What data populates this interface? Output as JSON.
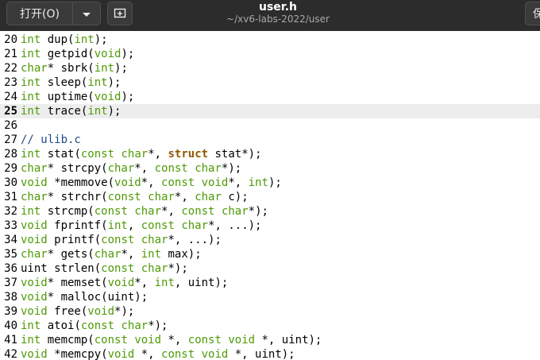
{
  "header": {
    "open_label": "打开(O)",
    "title": "user.h",
    "subtitle": "~/xv6-labs-2022/user",
    "right_label": "保"
  },
  "icons": {
    "dropdown": "chevron-down-icon",
    "new_tab": "new-tab-icon"
  },
  "colors": {
    "type": "#4e9a06",
    "keyword": "#8f5902",
    "comment": "#204a87",
    "current_line": "#ededed",
    "header_bg": "#2c2c2c"
  },
  "editor": {
    "current_line": 25,
    "lines": [
      {
        "num": "20",
        "tokens": [
          {
            "t": "int",
            "c": "type"
          },
          {
            "t": " dup(",
            "c": "plain"
          },
          {
            "t": "int",
            "c": "type"
          },
          {
            "t": ");",
            "c": "plain"
          }
        ]
      },
      {
        "num": "21",
        "tokens": [
          {
            "t": "int",
            "c": "type"
          },
          {
            "t": " getpid(",
            "c": "plain"
          },
          {
            "t": "void",
            "c": "type"
          },
          {
            "t": ");",
            "c": "plain"
          }
        ]
      },
      {
        "num": "22",
        "tokens": [
          {
            "t": "char",
            "c": "type"
          },
          {
            "t": "* sbrk(",
            "c": "plain"
          },
          {
            "t": "int",
            "c": "type"
          },
          {
            "t": ");",
            "c": "plain"
          }
        ]
      },
      {
        "num": "23",
        "tokens": [
          {
            "t": "int",
            "c": "type"
          },
          {
            "t": " sleep(",
            "c": "plain"
          },
          {
            "t": "int",
            "c": "type"
          },
          {
            "t": ");",
            "c": "plain"
          }
        ]
      },
      {
        "num": "24",
        "tokens": [
          {
            "t": "int",
            "c": "type"
          },
          {
            "t": " uptime(",
            "c": "plain"
          },
          {
            "t": "void",
            "c": "type"
          },
          {
            "t": ");",
            "c": "plain"
          }
        ]
      },
      {
        "num": "25",
        "tokens": [
          {
            "t": "int",
            "c": "type"
          },
          {
            "t": " trace(",
            "c": "plain"
          },
          {
            "t": "int",
            "c": "type"
          },
          {
            "t": ");",
            "c": "plain"
          }
        ]
      },
      {
        "num": "26",
        "tokens": []
      },
      {
        "num": "27",
        "tokens": [
          {
            "t": "// ulib.c",
            "c": "comment"
          }
        ]
      },
      {
        "num": "28",
        "tokens": [
          {
            "t": "int",
            "c": "type"
          },
          {
            "t": " stat(",
            "c": "plain"
          },
          {
            "t": "const",
            "c": "type"
          },
          {
            "t": " ",
            "c": "plain"
          },
          {
            "t": "char",
            "c": "type"
          },
          {
            "t": "*, ",
            "c": "plain"
          },
          {
            "t": "struct",
            "c": "kw"
          },
          {
            "t": " stat*);",
            "c": "plain"
          }
        ]
      },
      {
        "num": "29",
        "tokens": [
          {
            "t": "char",
            "c": "type"
          },
          {
            "t": "* strcpy(",
            "c": "plain"
          },
          {
            "t": "char",
            "c": "type"
          },
          {
            "t": "*, ",
            "c": "plain"
          },
          {
            "t": "const",
            "c": "type"
          },
          {
            "t": " ",
            "c": "plain"
          },
          {
            "t": "char",
            "c": "type"
          },
          {
            "t": "*);",
            "c": "plain"
          }
        ]
      },
      {
        "num": "30",
        "tokens": [
          {
            "t": "void",
            "c": "type"
          },
          {
            "t": " *memmove(",
            "c": "plain"
          },
          {
            "t": "void",
            "c": "type"
          },
          {
            "t": "*, ",
            "c": "plain"
          },
          {
            "t": "const",
            "c": "type"
          },
          {
            "t": " ",
            "c": "plain"
          },
          {
            "t": "void",
            "c": "type"
          },
          {
            "t": "*, ",
            "c": "plain"
          },
          {
            "t": "int",
            "c": "type"
          },
          {
            "t": ");",
            "c": "plain"
          }
        ]
      },
      {
        "num": "31",
        "tokens": [
          {
            "t": "char",
            "c": "type"
          },
          {
            "t": "* strchr(",
            "c": "plain"
          },
          {
            "t": "const",
            "c": "type"
          },
          {
            "t": " ",
            "c": "plain"
          },
          {
            "t": "char",
            "c": "type"
          },
          {
            "t": "*, ",
            "c": "plain"
          },
          {
            "t": "char",
            "c": "type"
          },
          {
            "t": " c);",
            "c": "plain"
          }
        ]
      },
      {
        "num": "32",
        "tokens": [
          {
            "t": "int",
            "c": "type"
          },
          {
            "t": " strcmp(",
            "c": "plain"
          },
          {
            "t": "const",
            "c": "type"
          },
          {
            "t": " ",
            "c": "plain"
          },
          {
            "t": "char",
            "c": "type"
          },
          {
            "t": "*, ",
            "c": "plain"
          },
          {
            "t": "const",
            "c": "type"
          },
          {
            "t": " ",
            "c": "plain"
          },
          {
            "t": "char",
            "c": "type"
          },
          {
            "t": "*);",
            "c": "plain"
          }
        ]
      },
      {
        "num": "33",
        "tokens": [
          {
            "t": "void",
            "c": "type"
          },
          {
            "t": " fprintf(",
            "c": "plain"
          },
          {
            "t": "int",
            "c": "type"
          },
          {
            "t": ", ",
            "c": "plain"
          },
          {
            "t": "const",
            "c": "type"
          },
          {
            "t": " ",
            "c": "plain"
          },
          {
            "t": "char",
            "c": "type"
          },
          {
            "t": "*, ...);",
            "c": "plain"
          }
        ]
      },
      {
        "num": "34",
        "tokens": [
          {
            "t": "void",
            "c": "type"
          },
          {
            "t": " printf(",
            "c": "plain"
          },
          {
            "t": "const",
            "c": "type"
          },
          {
            "t": " ",
            "c": "plain"
          },
          {
            "t": "char",
            "c": "type"
          },
          {
            "t": "*, ...);",
            "c": "plain"
          }
        ]
      },
      {
        "num": "35",
        "tokens": [
          {
            "t": "char",
            "c": "type"
          },
          {
            "t": "* gets(",
            "c": "plain"
          },
          {
            "t": "char",
            "c": "type"
          },
          {
            "t": "*, ",
            "c": "plain"
          },
          {
            "t": "int",
            "c": "type"
          },
          {
            "t": " max);",
            "c": "plain"
          }
        ]
      },
      {
        "num": "36",
        "tokens": [
          {
            "t": "uint strlen(",
            "c": "plain"
          },
          {
            "t": "const",
            "c": "type"
          },
          {
            "t": " ",
            "c": "plain"
          },
          {
            "t": "char",
            "c": "type"
          },
          {
            "t": "*);",
            "c": "plain"
          }
        ]
      },
      {
        "num": "37",
        "tokens": [
          {
            "t": "void",
            "c": "type"
          },
          {
            "t": "* memset(",
            "c": "plain"
          },
          {
            "t": "void",
            "c": "type"
          },
          {
            "t": "*, ",
            "c": "plain"
          },
          {
            "t": "int",
            "c": "type"
          },
          {
            "t": ", uint);",
            "c": "plain"
          }
        ]
      },
      {
        "num": "38",
        "tokens": [
          {
            "t": "void",
            "c": "type"
          },
          {
            "t": "* malloc(uint);",
            "c": "plain"
          }
        ]
      },
      {
        "num": "39",
        "tokens": [
          {
            "t": "void",
            "c": "type"
          },
          {
            "t": " free(",
            "c": "plain"
          },
          {
            "t": "void",
            "c": "type"
          },
          {
            "t": "*);",
            "c": "plain"
          }
        ]
      },
      {
        "num": "40",
        "tokens": [
          {
            "t": "int",
            "c": "type"
          },
          {
            "t": " atoi(",
            "c": "plain"
          },
          {
            "t": "const",
            "c": "type"
          },
          {
            "t": " ",
            "c": "plain"
          },
          {
            "t": "char",
            "c": "type"
          },
          {
            "t": "*);",
            "c": "plain"
          }
        ]
      },
      {
        "num": "41",
        "tokens": [
          {
            "t": "int",
            "c": "type"
          },
          {
            "t": " memcmp(",
            "c": "plain"
          },
          {
            "t": "const",
            "c": "type"
          },
          {
            "t": " ",
            "c": "plain"
          },
          {
            "t": "void",
            "c": "type"
          },
          {
            "t": " *, ",
            "c": "plain"
          },
          {
            "t": "const",
            "c": "type"
          },
          {
            "t": " ",
            "c": "plain"
          },
          {
            "t": "void",
            "c": "type"
          },
          {
            "t": " *, uint);",
            "c": "plain"
          }
        ]
      },
      {
        "num": "42",
        "tokens": [
          {
            "t": "void",
            "c": "type"
          },
          {
            "t": " *memcpy(",
            "c": "plain"
          },
          {
            "t": "void",
            "c": "type"
          },
          {
            "t": " *, ",
            "c": "plain"
          },
          {
            "t": "const",
            "c": "type"
          },
          {
            "t": " ",
            "c": "plain"
          },
          {
            "t": "void",
            "c": "type"
          },
          {
            "t": " *, uint);",
            "c": "plain"
          }
        ]
      }
    ]
  }
}
